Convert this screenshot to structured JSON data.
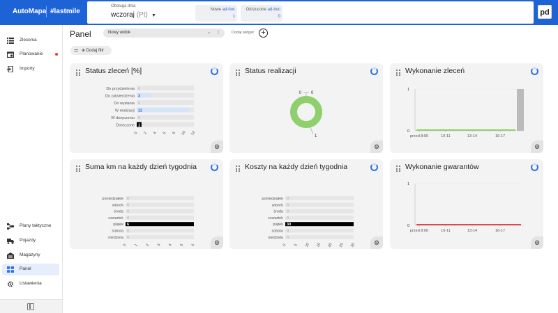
{
  "header": {
    "brand": "AutoMapa",
    "tag": "#lastmile",
    "date_label": "Obsługa dnia",
    "date_value": "wczoraj",
    "date_suffix": "(Pt)",
    "stats": [
      {
        "label": "Nowe",
        "tag": "ad-hoc",
        "value": "1"
      },
      {
        "label": "Odrzucone",
        "tag": "ad-hoc",
        "value": "0"
      }
    ],
    "logo": "pd"
  },
  "sidebar": {
    "top_items": [
      {
        "label": "Zlecenia",
        "icon": "list-icon"
      },
      {
        "label": "Planowanie",
        "icon": "calendar-icon",
        "dot": true
      },
      {
        "label": "Importy",
        "icon": "import-icon"
      }
    ],
    "bottom_items": [
      {
        "label": "Plany taktyczne",
        "icon": "plans-icon"
      },
      {
        "label": "Pojazdy",
        "icon": "truck-icon"
      },
      {
        "label": "Magazyny",
        "icon": "warehouse-icon"
      },
      {
        "label": "Panel",
        "icon": "dashboard-icon",
        "active": true
      },
      {
        "label": "Ustawienia",
        "icon": "gear-icon"
      }
    ]
  },
  "main": {
    "title": "Panel",
    "view_select": "Nowy widok",
    "add_widget": "Dodaj widget",
    "filter_label": "Dodaj filtr"
  },
  "widgets": [
    {
      "title": "Status zleceń [%]"
    },
    {
      "title": "Status realizacji"
    },
    {
      "title": "Wykonanie zleceń"
    },
    {
      "title": "Suma km na każdy dzień tygodnia"
    },
    {
      "title": "Koszty na każdy dzień tygodnia"
    },
    {
      "title": "Wykonanie gwarantów"
    }
  ],
  "chart_data": [
    {
      "type": "bar",
      "orientation": "horizontal",
      "categories": [
        "Do przydzielenia",
        "Do zatwierdzenia",
        "Do wysłania",
        "W realizacji",
        "W doręczeniu",
        "Doręczone"
      ],
      "values": [
        0,
        3,
        0,
        11,
        0,
        1
      ],
      "value_labels": [
        "0",
        "3",
        "0",
        "11",
        "0",
        "1"
      ],
      "xticks": [
        "0",
        "2",
        "4",
        "6",
        "8",
        "10",
        "12"
      ],
      "xlim": [
        0,
        12
      ],
      "colors": [
        "#e8e8e8",
        "#d6e4f8",
        "#e8e8e8",
        "#d6e4f8",
        "#e8e8e8",
        "#000000"
      ]
    },
    {
      "type": "pie",
      "style": "donut",
      "labels_top": [
        "0",
        "0"
      ],
      "label_bottom": "1",
      "values": [
        1
      ],
      "color": "#8fcf6e"
    },
    {
      "type": "bar",
      "x_ticks": [
        "przed 8:00",
        "10-11",
        "13-14",
        "16-17"
      ],
      "y_ticks": [
        "0",
        "1"
      ],
      "ylim": [
        0,
        1
      ],
      "last_bar": 1,
      "baseline_color": "#8fcf6e",
      "bar_color": "#bbbbbb"
    },
    {
      "type": "bar",
      "orientation": "horizontal",
      "categories": [
        "poniedziałek",
        "wtorek",
        "środa",
        "czwartek",
        "piątek",
        "sobota",
        "niedziela"
      ],
      "values": [
        0,
        0,
        0,
        0,
        6,
        0,
        0
      ],
      "value_labels": [
        "0",
        "0",
        "0",
        "0",
        "6",
        "0",
        "0"
      ],
      "xticks": [
        "0",
        "1",
        "2",
        "3",
        "4",
        "5",
        "6"
      ],
      "xlim": [
        0,
        6
      ]
    },
    {
      "type": "bar",
      "orientation": "horizontal",
      "categories": [
        "poniedziałek",
        "wtorek",
        "środa",
        "czwartek",
        "piątek",
        "sobota",
        "niedziela"
      ],
      "values": [
        0,
        0,
        0,
        0,
        30,
        0,
        0
      ],
      "value_labels": [
        "0",
        "0",
        "0",
        "0",
        "30",
        "0",
        "0"
      ],
      "xticks": [
        "0",
        "5",
        "10",
        "15",
        "20",
        "25",
        "30"
      ],
      "xlim": [
        0,
        30
      ]
    },
    {
      "type": "line",
      "x_ticks": [
        "przed 8:00",
        "10-11",
        "13-14",
        "16-17"
      ],
      "y_ticks": [
        "0",
        "1"
      ],
      "ylim": [
        0,
        1
      ],
      "baseline_color": "#e0464c"
    }
  ]
}
